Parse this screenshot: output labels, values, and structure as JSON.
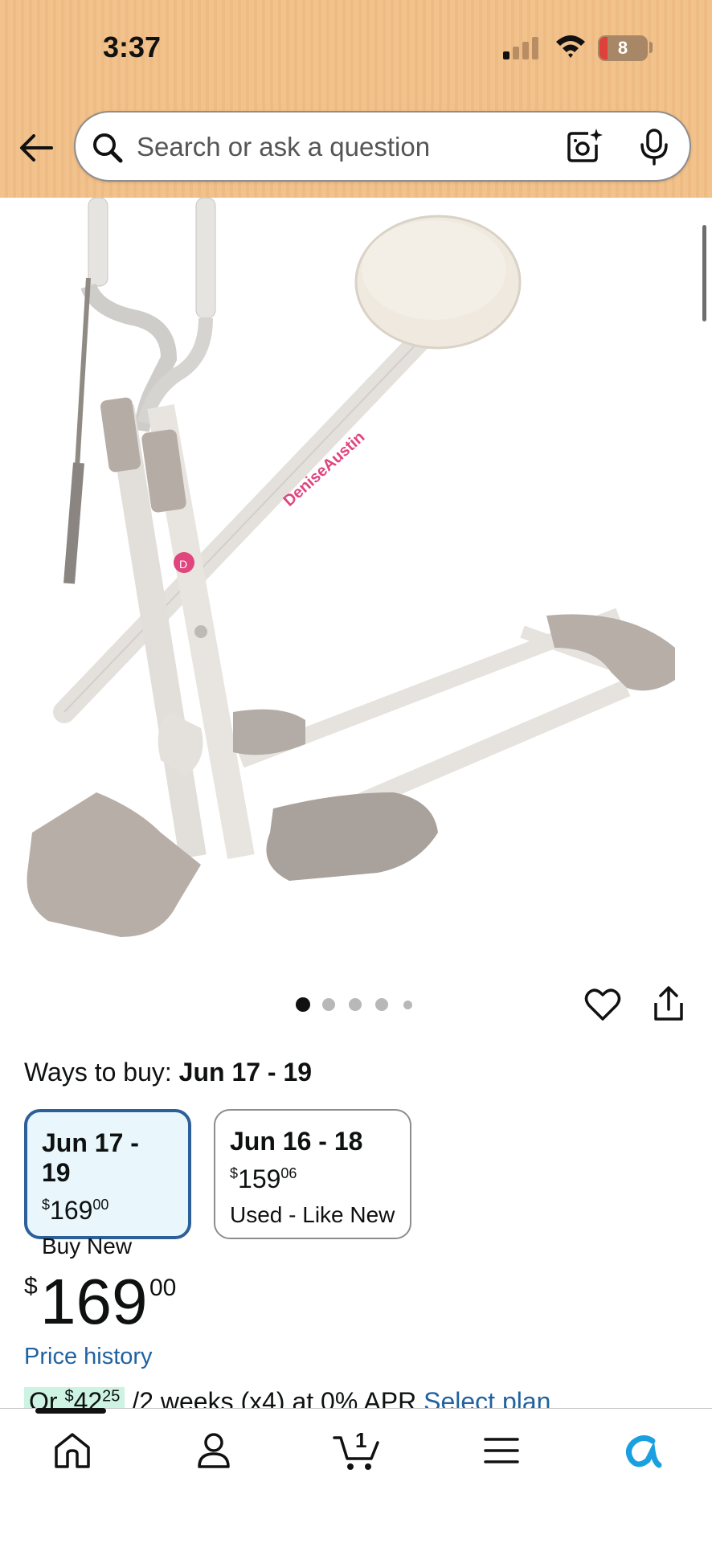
{
  "status_bar": {
    "time": "3:37",
    "battery": "8",
    "icons": [
      "signal-icon",
      "wifi-icon",
      "battery-icon"
    ]
  },
  "search": {
    "placeholder": "Search or ask a question",
    "icons": [
      "back-arrow-icon",
      "search-icon",
      "camera-lens-icon",
      "microphone-icon"
    ]
  },
  "product_image": {
    "brand_text": "DeniseAustin",
    "logo_letter": "D"
  },
  "carousel": {
    "total": 5,
    "active_index": 0
  },
  "actions": {
    "icons": [
      "heart-icon",
      "share-icon"
    ]
  },
  "ways_to_buy": {
    "label": "Ways to buy: ",
    "date": "Jun 17 - 19"
  },
  "buy_options": [
    {
      "date": "Jun 17 - 19",
      "currency": "$",
      "whole": "169",
      "fraction": "00",
      "condition": "Buy New",
      "selected": true
    },
    {
      "date": "Jun 16 - 18",
      "currency": "$",
      "whole": "159",
      "fraction": "06",
      "condition": "Used - Like New",
      "selected": false
    }
  ],
  "price": {
    "currency": "$",
    "whole": "169",
    "fraction": "00"
  },
  "price_history_label": "Price history",
  "installment": {
    "prefix": "Or ",
    "currency": "$",
    "amount": "42",
    "fraction": "25",
    "terms": " /2 weeks (x4) at 0% APR ",
    "link": "Select plan"
  },
  "bottom_nav": {
    "items": [
      "home-icon",
      "account-icon",
      "cart-icon",
      "menu-icon",
      "rufus-icon"
    ],
    "cart_count": "1",
    "accent": "#1aa0e0"
  },
  "colors": {
    "header": "#f2c28c",
    "link": "#2162a1",
    "selected_border": "#2d5f99",
    "brand_pink": "#e0457e"
  }
}
